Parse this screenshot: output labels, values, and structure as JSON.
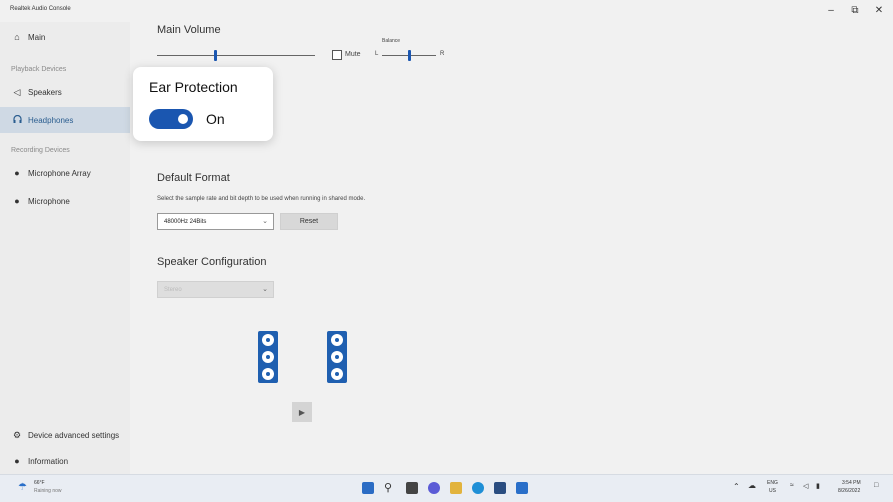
{
  "window": {
    "title": "Realtek Audio Console",
    "controls": [
      "–",
      "⧉",
      "✕"
    ]
  },
  "sidebar": {
    "main": {
      "label": "Main",
      "icon": "home-icon"
    },
    "playback_header": "Playback Devices",
    "playback_items": [
      {
        "label": "Speakers",
        "icon": "speaker-icon"
      },
      {
        "label": "Headphones",
        "icon": "headphones-icon",
        "selected": true
      }
    ],
    "recording_header": "Recording Devices",
    "recording_items": [
      {
        "label": "Microphone Array",
        "icon": "microphone-icon"
      },
      {
        "label": "Microphone",
        "icon": "microphone-icon"
      }
    ],
    "bottom_items": [
      {
        "label": "Device advanced settings",
        "icon": "gear-icon"
      },
      {
        "label": "Information",
        "icon": "info-icon"
      }
    ]
  },
  "main": {
    "volume": {
      "title": "Main Volume",
      "mute_label": "Mute",
      "balance_label": "Balance",
      "left": "L",
      "right": "R",
      "volume_level": 0.37,
      "balance_level": 0.5,
      "muted": false
    },
    "ear_protection": {
      "title": "Ear Protection",
      "state": "On"
    },
    "default_format": {
      "title": "Default Format",
      "description": "Select the sample rate and bit depth to be used when running in shared mode.",
      "selected": "48000Hz 24Bits",
      "reset_label": "Reset"
    },
    "speaker_config": {
      "title": "Speaker Configuration",
      "selected": "Stereo"
    }
  },
  "taskbar": {
    "weather_temp": "66°F",
    "weather_desc": "Raining now",
    "lang_top": "ENG",
    "lang_bottom": "US",
    "time": "3:54 PM",
    "date": "8/26/2022"
  },
  "colors": {
    "accent": "#1a56b0",
    "selected_bg": "#cfd9e4"
  }
}
